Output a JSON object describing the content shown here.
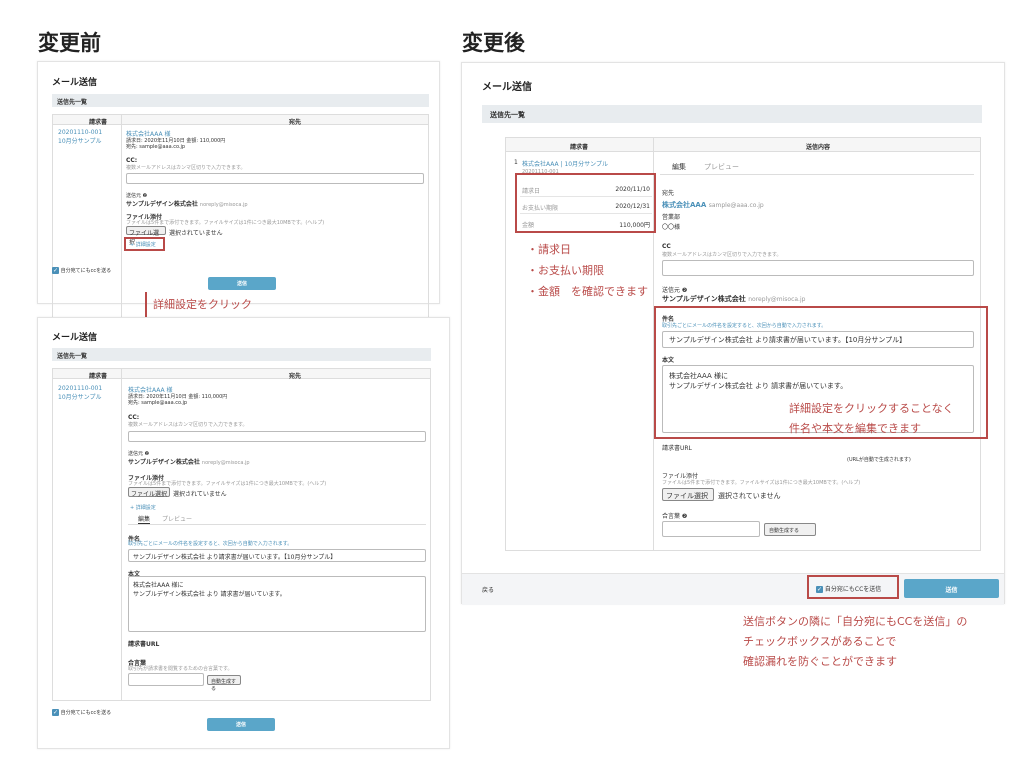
{
  "headings": {
    "before": "変更前",
    "after": "変更後"
  },
  "common": {
    "window_title": "メール送信",
    "band": "送信先一覧",
    "col_invoice": "請求書",
    "col_dest": "宛先",
    "col_content": "送信内容",
    "invoice_link_before": "20201110-001",
    "invoice_link_before2": "10月分サンプル",
    "company": "株式会社AAA 様",
    "company_meta": "請求日: 2020年11月10日 金額: 110,000円",
    "email_line": "宛先: sample@aaa.co.jp",
    "cc_label": "CC:",
    "cc_help": "複数メールアドレスはカンマ区切りで入力できます。",
    "sender_label": "送信元 ❷",
    "sender_value": "サンプルデザイン株式会社",
    "sender_email": "noreply@misoca.jp",
    "file_label": "ファイル添付",
    "file_help": "ファイルは5件まで添付できます。ファイルサイズは1件につき最大10MBです。(ヘルプ)",
    "file_button": "ファイル選択",
    "file_none": "選択されていません",
    "detail_toggle": "+ 詳細設定",
    "cc_self": "自分宛てにもccを送る",
    "send": "送信",
    "tab_edit": "編集",
    "tab_preview": "プレビュー",
    "subject_label": "件名",
    "subject_help": "取引先ごとにメールの件名を設定すると、次回から自動で入力されます。",
    "subject_value": "サンプルデザイン株式会社 より請求書が届いています。【10月分サンプル】",
    "body_label": "本文",
    "body_line1": "株式会社AAA 様に",
    "body_line2": "サンプルデザイン株式会社 より 請求書が届いています。",
    "invoice_url_label": "請求書URL",
    "password_label": "合言葉",
    "password_help": "取引先が請求書を閲覧するための合言葉です。",
    "password_button": "自動生成する"
  },
  "after": {
    "row_no": "1",
    "invoice_link": "株式会社AAA | 10月分サンプル",
    "invoice_no": "20201110-001",
    "date_rows": [
      {
        "label": "請求日",
        "value": "2020/11/10"
      },
      {
        "label": "お支払い期限",
        "value": "2020/12/31"
      },
      {
        "label": "金額",
        "value": "110,000円"
      }
    ],
    "dest_label": "宛先",
    "dest_company": "株式会社AAA",
    "dest_email": "sample@aaa.co.jp",
    "dept": "営業部",
    "person": "〇〇様",
    "cc_label": "CC",
    "sender_label": "送信元 ❷",
    "sender_value": "サンプルデザイン株式会社",
    "sender_email": "noreply@misoca.jp",
    "subject_label": "件名",
    "invoice_url_label": "請求書URL",
    "invoice_url_note": "(URLが自動で生成されます)",
    "file_help": "ファイルは5件まで添付できます。ファイルサイズは1件につき最大10MBです。(ヘルプ)",
    "password_label": "合言葉 ❷",
    "back": "戻る",
    "cc_self": "自分宛にもCCを送信",
    "send": "送信"
  },
  "annotations": {
    "click_detail": "詳細設定をクリック",
    "bullets": [
      "・請求日",
      "・お支払い期限",
      "・金額　を確認できます"
    ],
    "edit_note_1": "詳細設定をクリックすることなく",
    "edit_note_2": "件名や本文を編集できます",
    "cc_note_1": "送信ボタンの隣に「自分宛にもCCを送信」の",
    "cc_note_2": "チェックボックスがあることで",
    "cc_note_3": "確認漏れを防ぐことができます"
  },
  "colors": {
    "accent": "#5aa6c9",
    "annotation": "#b94a48",
    "band": "#e8ecef"
  }
}
